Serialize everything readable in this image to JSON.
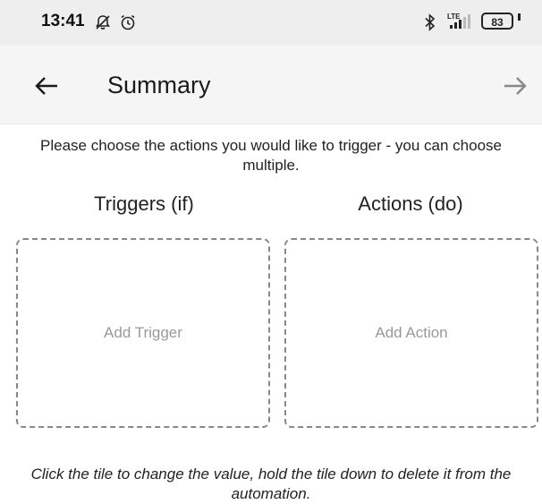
{
  "status_bar": {
    "time": "13:41",
    "battery_level": "83",
    "network_label": "LTE",
    "icons": [
      "alarm-off-icon",
      "alarm-clock-icon",
      "bluetooth-icon",
      "signal-icon",
      "battery-icon"
    ]
  },
  "app_bar": {
    "title": "Summary",
    "back_icon": "arrow-left-icon",
    "next_icon": "arrow-right-icon"
  },
  "main": {
    "instruction": "Please choose the actions you would like to trigger - you can choose multiple.",
    "triggers": {
      "heading": "Triggers (if)",
      "tile_label": "Add Trigger"
    },
    "actions": {
      "heading": "Actions (do)",
      "tile_label": "Add Action"
    },
    "footer_hint": "Click the tile to change the value, hold the tile down to delete it from the automation."
  },
  "colors": {
    "status_bar_bg": "#eeeeee",
    "app_bar_bg": "#f5f5f5",
    "tile_border": "#888888",
    "tile_label": "#999999"
  }
}
